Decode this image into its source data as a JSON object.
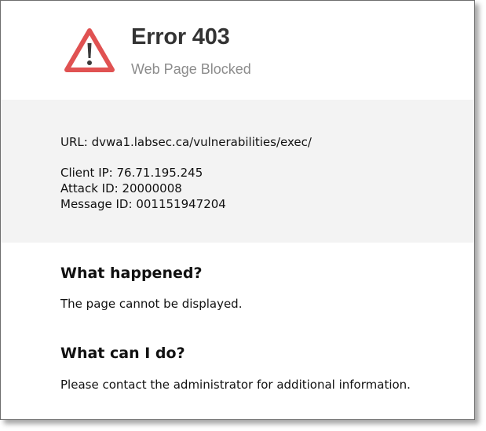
{
  "header": {
    "title": "Error 403",
    "subtitle": "Web Page Blocked",
    "icon": "warning-triangle-icon",
    "icon_color": "#e05252"
  },
  "info": {
    "url_label": "URL:",
    "url_value": "dvwa1.labsec.ca/vulnerabilities/exec/",
    "client_ip_label": "Client IP:",
    "client_ip_value": "76.71.195.245",
    "attack_id_label": "Attack ID:",
    "attack_id_value": "20000008",
    "message_id_label": "Message ID:",
    "message_id_value": "001151947204"
  },
  "sections": {
    "what_happened_heading": "What happened?",
    "what_happened_text": "The page cannot be displayed.",
    "what_can_i_do_heading": "What can I do?",
    "what_can_i_do_text": "Please contact the administrator for additional information."
  }
}
